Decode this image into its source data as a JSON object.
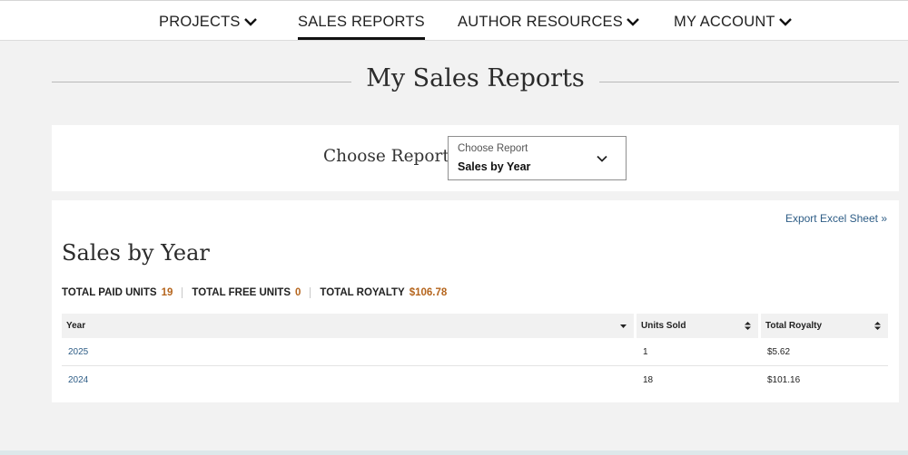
{
  "nav": {
    "items": [
      {
        "label": "PROJECTS",
        "has_dropdown": true,
        "active": false
      },
      {
        "label": "SALES REPORTS",
        "has_dropdown": false,
        "active": true
      },
      {
        "label": "AUTHOR RESOURCES",
        "has_dropdown": true,
        "active": false
      },
      {
        "label": "MY ACCOUNT",
        "has_dropdown": true,
        "active": false
      }
    ]
  },
  "page": {
    "title": "My Sales Reports"
  },
  "report_picker": {
    "label": "Choose Report",
    "select_floating_label": "Choose Report",
    "selected_value": "Sales by Year"
  },
  "sales": {
    "export_link": "Export Excel Sheet »",
    "title": "Sales by Year",
    "totals": [
      {
        "label": "TOTAL PAID UNITS",
        "value": "19"
      },
      {
        "label": "TOTAL FREE UNITS",
        "value": "0"
      },
      {
        "label": "TOTAL ROYALTY",
        "value": "$106.78"
      }
    ],
    "table": {
      "headers": [
        "Year",
        "Units Sold",
        "Total Royalty"
      ],
      "rows": [
        {
          "year": "2025",
          "units": "1",
          "royalty": "$5.62"
        },
        {
          "year": "2024",
          "units": "18",
          "royalty": "$101.16"
        }
      ]
    }
  },
  "colors": {
    "accent_number": "#b5651d",
    "link": "#2e5d86",
    "background": "#f2f2f2"
  }
}
